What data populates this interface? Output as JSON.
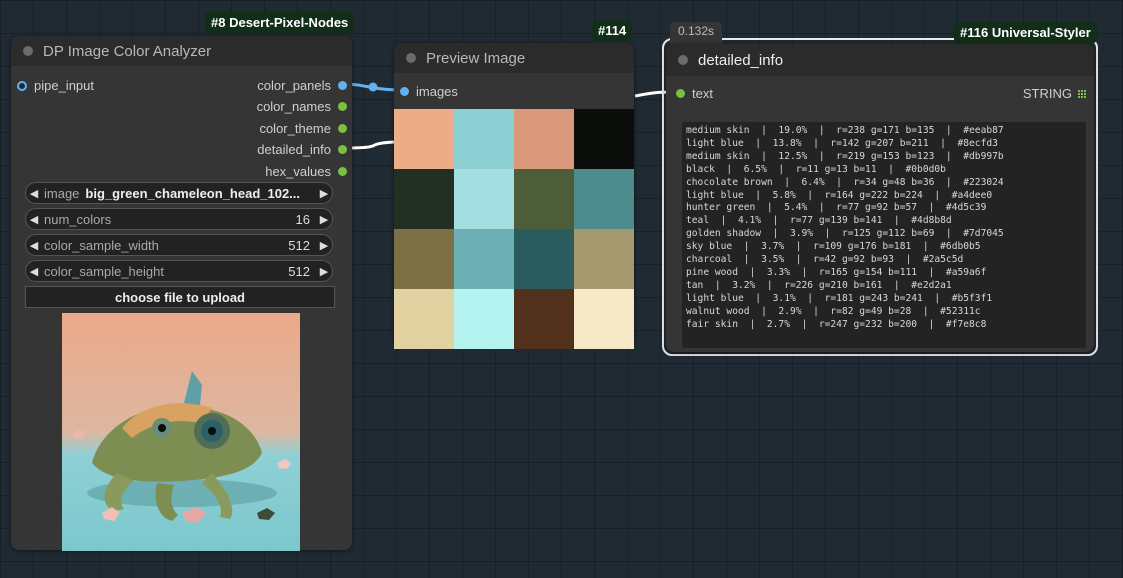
{
  "colors": {
    "canvas_bg": "#202a33",
    "node_bg": "#353535",
    "badge_bg": "#122e19",
    "link_blue": "#62b1f1",
    "link_white": "#ffffff",
    "slot_green": "#7ac142"
  },
  "node8": {
    "badge": "#8 Desert-Pixel-Nodes",
    "title": "DP Image Color Analyzer",
    "inputs": [
      "pipe_input"
    ],
    "outputs": [
      "color_panels",
      "color_names",
      "color_theme",
      "detailed_info",
      "hex_values"
    ],
    "widgets": {
      "image_label": "image",
      "image_value": "big_green_chameleon_head_102...",
      "num_colors_label": "num_colors",
      "num_colors_value": "16",
      "sample_width_label": "color_sample_width",
      "sample_width_value": "512",
      "sample_height_label": "color_sample_height",
      "sample_height_value": "512"
    },
    "upload_label": "choose file to upload",
    "preview_icon": "chameleon-image"
  },
  "node114": {
    "badge": "#114",
    "title": "Preview Image",
    "input": "images",
    "swatches": [
      "#eeab87",
      "#8ecfd3",
      "#db997b",
      "#0b0d0b",
      "#223024",
      "#a4dee0",
      "#4d5c39",
      "#4d8b8d",
      "#7d7045",
      "#6db0b5",
      "#2a5c5d",
      "#a59a6f",
      "#e2d2a1",
      "#b5f3f1",
      "#52311c",
      "#f7e8c8"
    ]
  },
  "node116": {
    "badge": "#116 Universal-Styler",
    "timing": "0.132s",
    "title": "detailed_info",
    "input": "text",
    "output": "STRING",
    "lines": [
      "medium skin  |  19.0%  |  r=238 g=171 b=135  |  #eeab87",
      "light blue  |  13.8%  |  r=142 g=207 b=211  |  #8ecfd3",
      "medium skin  |  12.5%  |  r=219 g=153 b=123  |  #db997b",
      "black  |  6.5%  |  r=11 g=13 b=11  |  #0b0d0b",
      "chocolate brown  |  6.4%  |  r=34 g=48 b=36  |  #223024",
      "light blue  |  5.8%  |  r=164 g=222 b=224  |  #a4dee0",
      "hunter green  |  5.4%  |  r=77 g=92 b=57  |  #4d5c39",
      "teal  |  4.1%  |  r=77 g=139 b=141  |  #4d8b8d",
      "golden shadow  |  3.9%  |  r=125 g=112 b=69  |  #7d7045",
      "sky blue  |  3.7%  |  r=109 g=176 b=181  |  #6db0b5",
      "charcoal  |  3.5%  |  r=42 g=92 b=93  |  #2a5c5d",
      "pine wood  |  3.3%  |  r=165 g=154 b=111  |  #a59a6f",
      "tan  |  3.2%  |  r=226 g=210 b=161  |  #e2d2a1",
      "light blue  |  3.1%  |  r=181 g=243 b=241  |  #b5f3f1",
      "walnut wood  |  2.9%  |  r=82 g=49 b=28  |  #52311c",
      "fair skin  |  2.7%  |  r=247 g=232 b=200  |  #f7e8c8"
    ]
  }
}
